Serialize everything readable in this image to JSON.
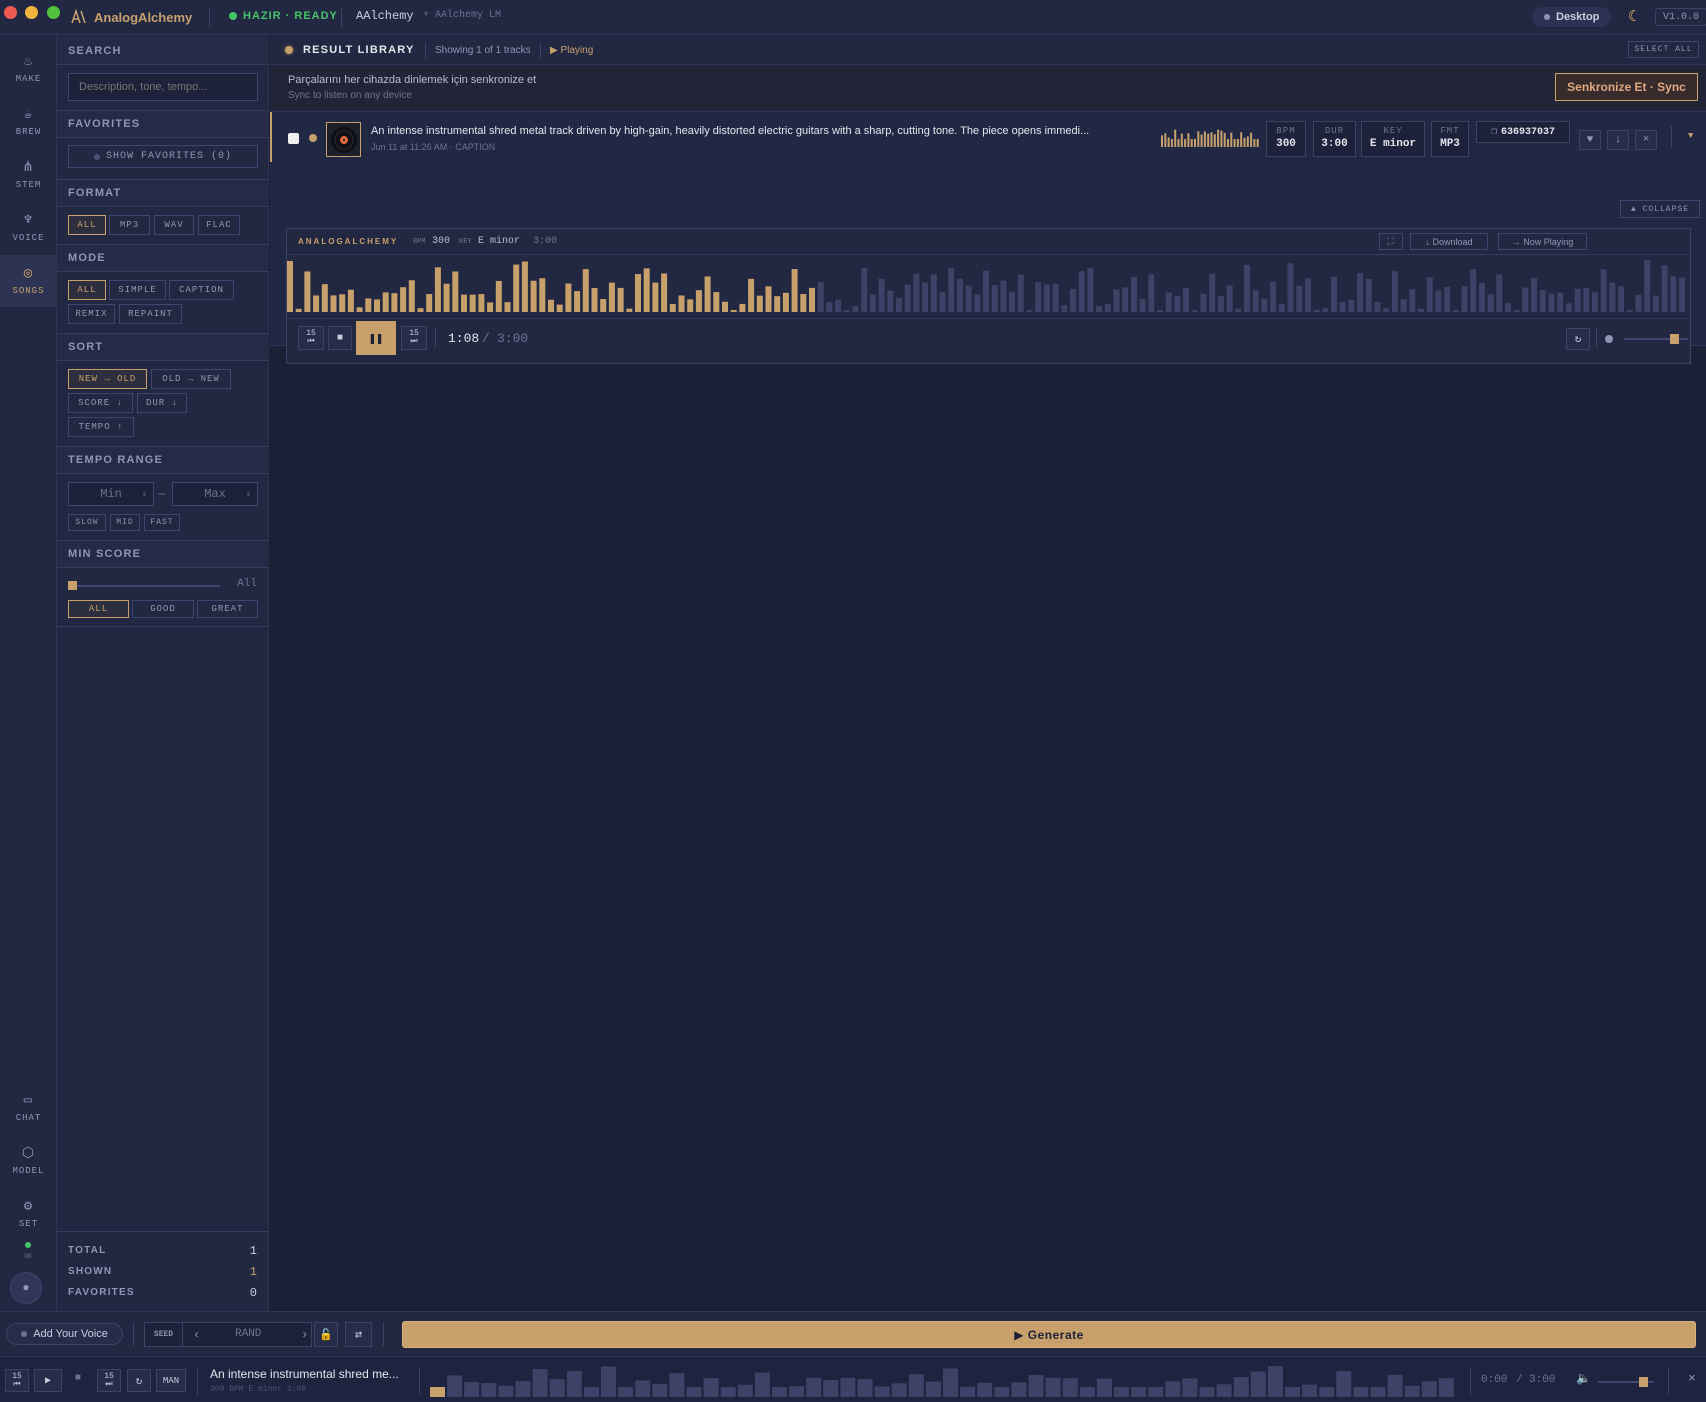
{
  "titlebar": {
    "brand": "AnalogAlchemy",
    "status": "HAZIR · READY",
    "app_name": "AAlchemy",
    "model_name": "+ AAlchemy LM",
    "device": "Desktop",
    "version": "V1.0.0"
  },
  "rail": {
    "items": [
      {
        "label": "MAKE",
        "icon": "flame-icon"
      },
      {
        "label": "BREW",
        "icon": "cauldron-icon"
      },
      {
        "label": "STEM",
        "icon": "stem-icon"
      },
      {
        "label": "VOICE",
        "icon": "microphone-icon"
      },
      {
        "label": "SONGS",
        "icon": "disc-icon"
      }
    ],
    "bottom_items": [
      {
        "label": "CHAT",
        "icon": "chat-icon"
      },
      {
        "label": "MODEL",
        "icon": "cube-icon"
      },
      {
        "label": "SET",
        "icon": "gear-icon"
      }
    ],
    "online_label": "ON"
  },
  "filters": {
    "search": {
      "title": "SEARCH",
      "placeholder": "Description, tone, tempo..."
    },
    "favorites": {
      "title": "FAVORITES",
      "button": "SHOW FAVORITES (0)"
    },
    "format": {
      "title": "FORMAT",
      "options": [
        "ALL",
        "MP3",
        "WAV",
        "FLAC"
      ],
      "selected": "ALL"
    },
    "mode": {
      "title": "MODE",
      "options": [
        "ALL",
        "SIMPLE",
        "CAPTION",
        "REMIX",
        "REPAINT"
      ],
      "selected": "ALL"
    },
    "sort": {
      "title": "SORT",
      "options": [
        "NEW → OLD",
        "OLD → NEW",
        "SCORE ↓",
        "DUR ↓",
        "TEMPO ↑"
      ],
      "selected": "NEW → OLD"
    },
    "tempo": {
      "title": "TEMPO RANGE",
      "min_placeholder": "Min",
      "max_placeholder": "Max",
      "separator": "—",
      "presets": [
        "SLOW",
        "MID",
        "FAST"
      ]
    },
    "score": {
      "title": "MIN SCORE",
      "value_label": "All",
      "options": [
        "ALL",
        "GOOD",
        "GREAT"
      ],
      "selected": "ALL"
    }
  },
  "stats": {
    "total_label": "TOTAL",
    "total": "1",
    "shown_label": "SHOWN",
    "shown": "1",
    "favorites_label": "FAVORITES",
    "favorites": "0"
  },
  "library": {
    "title": "RESULT LIBRARY",
    "showing": "Showing 1 of 1 tracks",
    "playing": "▶ Playing",
    "select_all": "SELECT ALL"
  },
  "sync": {
    "text": "Parçalarını her cihazda dinlemek için senkronize et",
    "subtext": "Sync to listen on any device",
    "button": "Senkronize Et · Sync"
  },
  "track": {
    "title": "An intense instrumental shred metal track driven by high-gain, heavily distorted electric guitars with a sharp, cutting tone. The piece opens immedi...",
    "meta": "Jun 11 at 11:26 AM · CAPTION",
    "bpm_label": "BPM",
    "bpm": "300",
    "dur_label": "DUR",
    "dur": "3:00",
    "key_label": "KEY",
    "key": "E minor",
    "fmt_label": "FMT",
    "fmt": "MP3",
    "seed": "636937037",
    "collapse": "▲ COLLAPSE"
  },
  "player": {
    "brand": "ANALOGALCHEMY",
    "bpm_label": "BPM",
    "bpm": "300",
    "key_label": "KEY",
    "key": "E minor",
    "duration": "3:00",
    "download": "↓ Download",
    "now_playing": "→ Now Playing",
    "current": "1:08",
    "total": "3:00",
    "separator": "/",
    "skip": "15",
    "progress": 0.378,
    "volume": 0.78
  },
  "generate": {
    "voice": "Add Your Voice",
    "seed_label": "SEED",
    "seed_value": "RAND",
    "button": "▶ Generate"
  },
  "transport": {
    "skip": "15",
    "mode": "MAN",
    "title": "An intense instrumental shred me...",
    "meta": "300 BPM  E minor  3:00",
    "time": "0:00",
    "total": "3:00",
    "separator": "/",
    "volume": 0.8
  },
  "colors": {
    "accent": "#c8a06c",
    "ready": "#46c46a",
    "bg": "#1b2037",
    "panel": "#222842"
  }
}
